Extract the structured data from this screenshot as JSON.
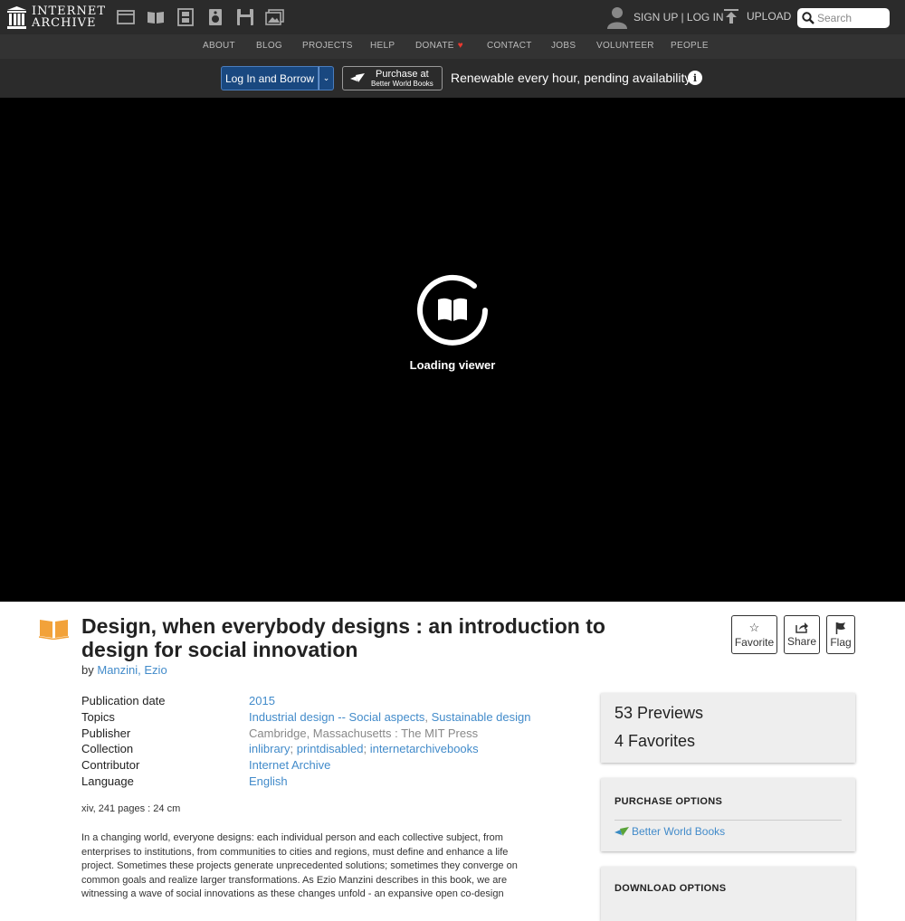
{
  "header": {
    "logo_line1": "INTERNET",
    "logo_line2": "ARCHIVE",
    "media_icons": [
      "web-icon",
      "texts-icon",
      "video-icon",
      "audio-icon",
      "software-icon",
      "images-icon"
    ],
    "auth_label": "SIGN UP | LOG IN",
    "upload_label": "UPLOAD",
    "search_placeholder": "Search"
  },
  "nav": {
    "items": [
      "ABOUT",
      "BLOG",
      "PROJECTS",
      "HELP",
      "DONATE",
      "CONTACT",
      "JOBS",
      "VOLUNTEER",
      "PEOPLE"
    ]
  },
  "borrow": {
    "login_borrow": "Log In and Borrow",
    "purchase_line1": "Purchase at",
    "purchase_line2": "Better World Books",
    "renewable": "Renewable every hour, pending availability."
  },
  "viewer": {
    "loading": "Loading viewer"
  },
  "item": {
    "title": "Design, when everybody designs : an introduction to design for social innovation",
    "by_label": "by",
    "author": "Manzini, Ezio",
    "actions": {
      "favorite": "Favorite",
      "share": "Share",
      "flag": "Flag"
    },
    "metadata": {
      "pubdate_label": "Publication date",
      "pubdate": "2015",
      "topics_label": "Topics",
      "topic1": "Industrial design -- Social aspects",
      "topic2": "Sustainable design",
      "publisher_label": "Publisher",
      "publisher": "Cambridge, Massachusetts : The MIT Press",
      "collection_label": "Collection",
      "collection1": "inlibrary",
      "collection2": "printdisabled",
      "collection3": "internetarchivebooks",
      "contributor_label": "Contributor",
      "contributor": "Internet Archive",
      "language_label": "Language",
      "language": "English"
    },
    "extent": "xiv, 241 pages : 24 cm",
    "description": "In a changing world, everyone designs: each individual person and each collective subject, from enterprises to institutions, from communities to cities and regions, must define and enhance a life project. Sometimes these projects generate unprecedented solutions; sometimes they converge on common goals and realize larger transformations. As Ezio Manzini describes in this book, we are witnessing a wave of social innovations as these changes unfold - an expansive open co-design"
  },
  "sidebar": {
    "previews": "53 Previews",
    "favorites": "4 Favorites",
    "purchase_heading": "PURCHASE OPTIONS",
    "purchase_link": "Better World Books",
    "download_heading": "DOWNLOAD OPTIONS"
  },
  "colors": {
    "link": "#428bca",
    "borrow_button": "#194880",
    "book_icon": "#f2a23a",
    "heart": "#e8392f"
  }
}
